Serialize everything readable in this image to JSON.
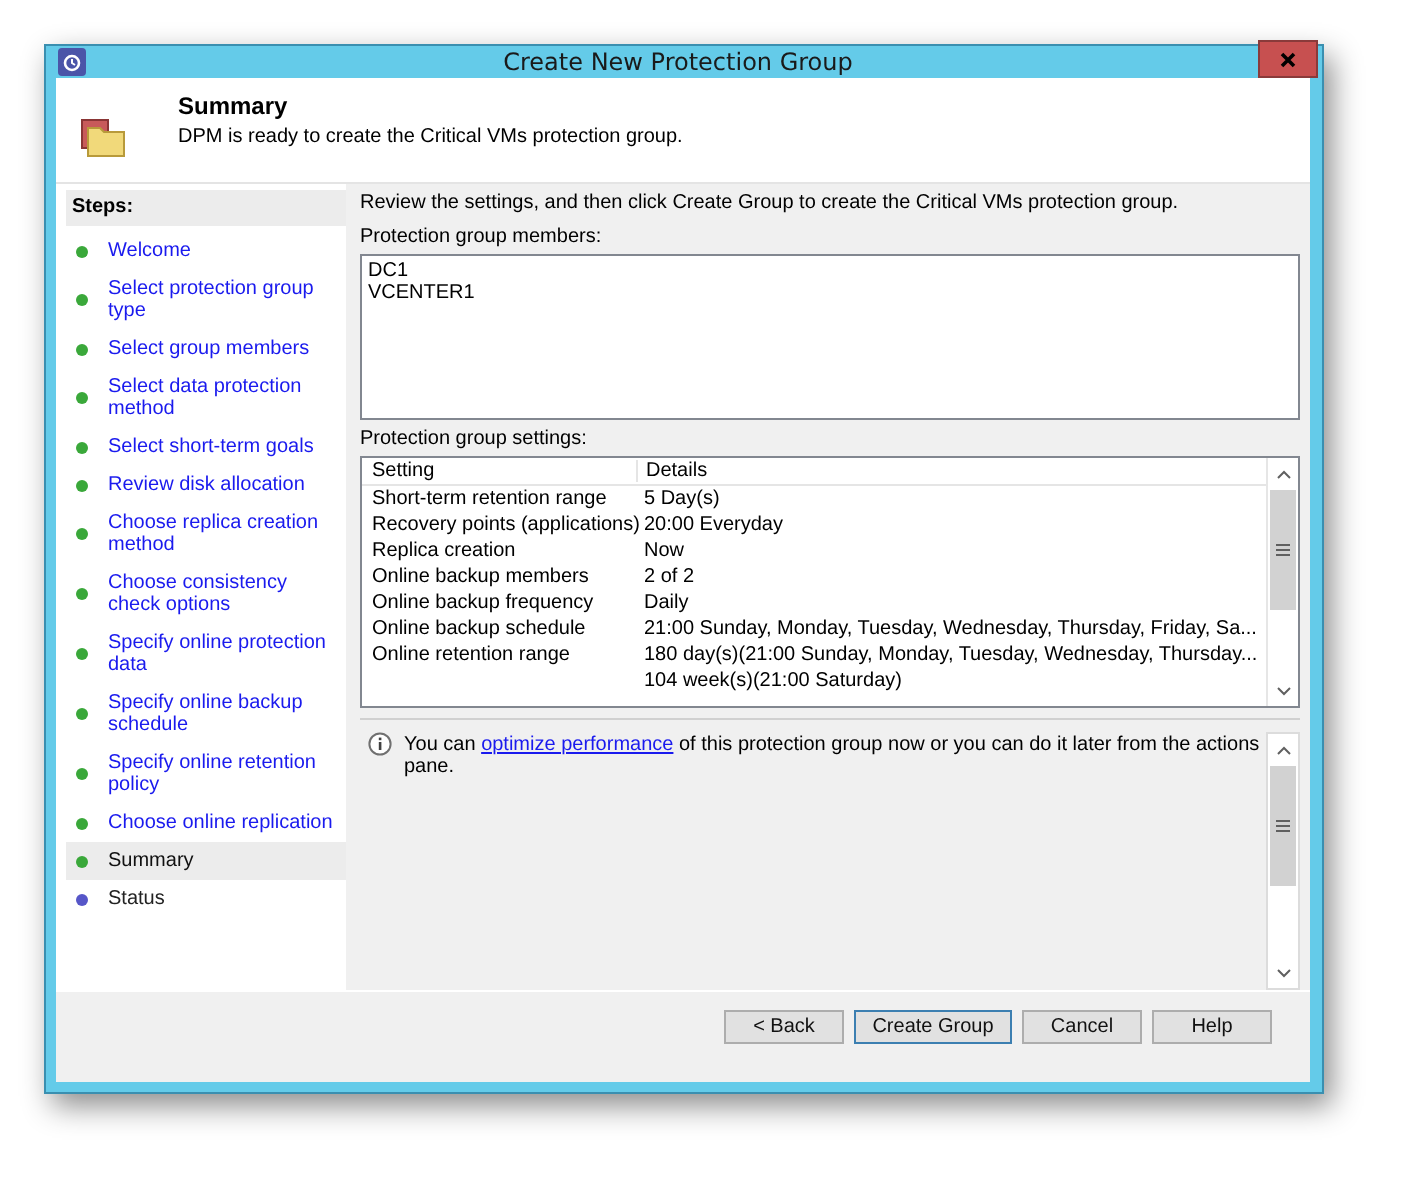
{
  "window": {
    "title": "Create New Protection Group"
  },
  "header": {
    "title": "Summary",
    "subtitle": "DPM is ready to create the Critical VMs protection group."
  },
  "steps": {
    "heading": "Steps:",
    "items": [
      {
        "label": "Welcome",
        "color": "#3aa83a",
        "completed": true,
        "selected": false
      },
      {
        "label": "Select protection group type",
        "color": "#3aa83a",
        "completed": true,
        "selected": false
      },
      {
        "label": "Select group members",
        "color": "#3aa83a",
        "completed": true,
        "selected": false
      },
      {
        "label": "Select data protection method",
        "color": "#3aa83a",
        "completed": true,
        "selected": false
      },
      {
        "label": "Select short-term goals",
        "color": "#3aa83a",
        "completed": true,
        "selected": false
      },
      {
        "label": "Review disk allocation",
        "color": "#3aa83a",
        "completed": true,
        "selected": false
      },
      {
        "label": "Choose replica creation method",
        "color": "#3aa83a",
        "completed": true,
        "selected": false
      },
      {
        "label": "Choose consistency check options",
        "color": "#3aa83a",
        "completed": true,
        "selected": false
      },
      {
        "label": "Specify online protection data",
        "color": "#3aa83a",
        "completed": true,
        "selected": false
      },
      {
        "label": "Specify online backup schedule",
        "color": "#3aa83a",
        "completed": true,
        "selected": false
      },
      {
        "label": "Specify online retention policy",
        "color": "#3aa83a",
        "completed": true,
        "selected": false
      },
      {
        "label": "Choose online replication",
        "color": "#3aa83a",
        "completed": true,
        "selected": false
      },
      {
        "label": "Summary",
        "color": "#3aa83a",
        "completed": true,
        "selected": true
      },
      {
        "label": "Status",
        "color": "#5656c8",
        "completed": false,
        "selected": false
      }
    ]
  },
  "intro": "Review the settings, and then click Create Group to create the Critical VMs protection group.",
  "members": {
    "label": "Protection group members:",
    "items": [
      "DC1",
      "VCENTER1"
    ]
  },
  "settings": {
    "label": "Protection group settings:",
    "columns": [
      "Setting",
      "Details"
    ],
    "rows": [
      [
        "Short-term retention range",
        "5 Day(s)"
      ],
      [
        "Recovery points (applications)",
        "20:00 Everyday"
      ],
      [
        "Replica creation",
        "Now"
      ],
      [
        "Online backup members",
        "2 of 2"
      ],
      [
        "Online backup frequency",
        "Daily"
      ],
      [
        "Online backup schedule",
        "21:00 Sunday, Monday, Tuesday, Wednesday, Thursday, Friday, Sa..."
      ],
      [
        "Online retention range",
        "180 day(s)(21:00 Sunday, Monday, Tuesday, Wednesday, Thursday..."
      ],
      [
        "",
        "104 week(s)(21:00 Saturday)"
      ]
    ]
  },
  "info": {
    "before": "You can ",
    "link": "optimize performance",
    "after": " of this protection group now or you can do it later from the actions pane."
  },
  "buttons": [
    {
      "label": "< Back",
      "default": false
    },
    {
      "label": "Create Group",
      "default": true
    },
    {
      "label": "Cancel",
      "default": false
    },
    {
      "label": "Help",
      "default": false
    }
  ]
}
